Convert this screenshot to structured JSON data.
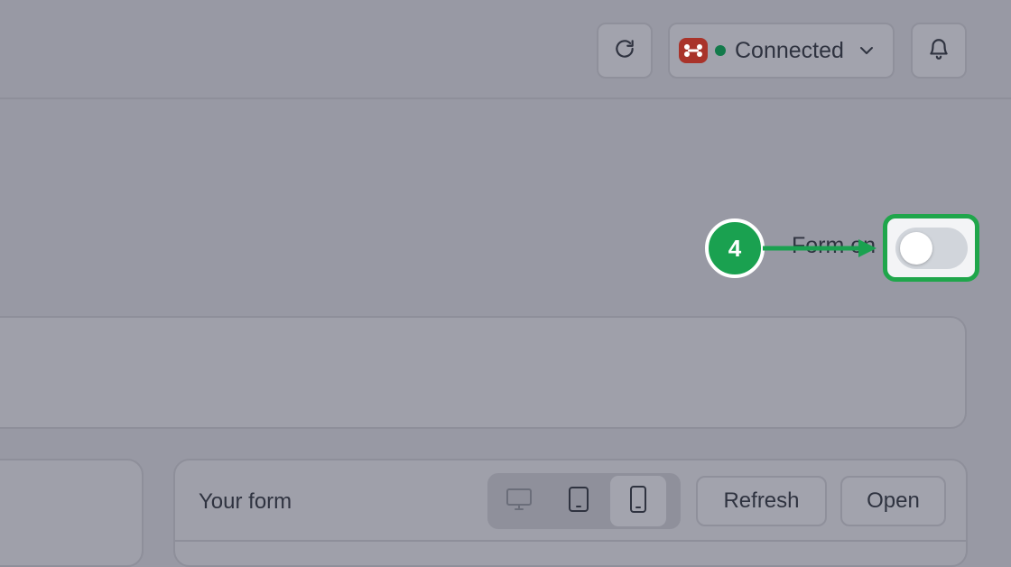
{
  "header": {
    "connection": {
      "status_label": "Connected",
      "status_color": "#137a4b",
      "brand_icon": "connector-logo-icon",
      "brand_color": "#a9332a"
    },
    "refresh_icon": "refresh-icon",
    "notifications_icon": "bell-icon"
  },
  "settings": {
    "form_label": "Form on",
    "form_enabled": false
  },
  "callout": {
    "step": "4",
    "color": "#1aa150"
  },
  "preview": {
    "title": "Your form",
    "devices": [
      {
        "name": "desktop",
        "icon": "desktop-icon",
        "active": false
      },
      {
        "name": "tablet",
        "icon": "tablet-icon",
        "active": false
      },
      {
        "name": "mobile",
        "icon": "mobile-icon",
        "active": true
      }
    ],
    "refresh_label": "Refresh",
    "open_label": "Open"
  }
}
